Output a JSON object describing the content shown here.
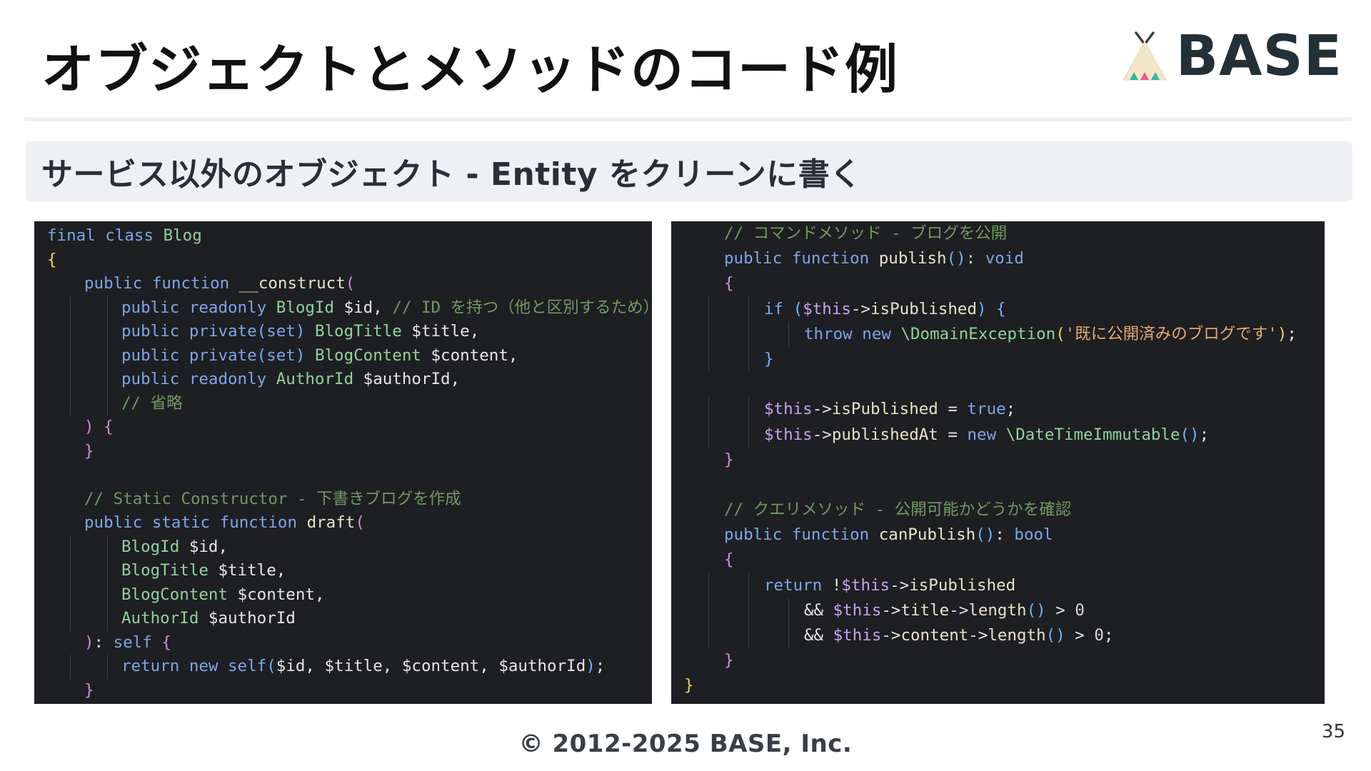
{
  "header": {
    "title": "オブジェクトとメソッドのコード例",
    "logo_text": "BASE"
  },
  "subtitle": "サービス以外のオブジェクト - Entity をクリーンに書く",
  "left_code": {
    "lines": [
      {
        "indent": 0,
        "tokens": [
          [
            "kw",
            "final "
          ],
          [
            "kw",
            "class "
          ],
          [
            "ty",
            "Blog"
          ]
        ]
      },
      {
        "indent": 0,
        "tokens": [
          [
            "br1",
            "{"
          ]
        ]
      },
      {
        "indent": 1,
        "tokens": [
          [
            "kw",
            "public "
          ],
          [
            "kw",
            "function "
          ],
          [
            "fn",
            "__construct"
          ],
          [
            "br2",
            "("
          ]
        ]
      },
      {
        "indent": 2,
        "tokens": [
          [
            "kw",
            "public "
          ],
          [
            "kw",
            "readonly "
          ],
          [
            "ty",
            "BlogId "
          ],
          [
            "vr",
            "$id"
          ],
          [
            "pl",
            ", "
          ],
          [
            "cm",
            "// ID を持つ（他と区別するため）"
          ]
        ]
      },
      {
        "indent": 2,
        "tokens": [
          [
            "kw",
            "public "
          ],
          [
            "kw",
            "private"
          ],
          [
            "br3",
            "("
          ],
          [
            "kw",
            "set"
          ],
          [
            "br3",
            ")"
          ],
          [
            "pl",
            " "
          ],
          [
            "ty",
            "BlogTitle "
          ],
          [
            "vr",
            "$title"
          ],
          [
            "pl",
            ","
          ]
        ]
      },
      {
        "indent": 2,
        "tokens": [
          [
            "kw",
            "public "
          ],
          [
            "kw",
            "private"
          ],
          [
            "br3",
            "("
          ],
          [
            "kw",
            "set"
          ],
          [
            "br3",
            ")"
          ],
          [
            "pl",
            " "
          ],
          [
            "ty",
            "BlogContent "
          ],
          [
            "vr",
            "$content"
          ],
          [
            "pl",
            ","
          ]
        ]
      },
      {
        "indent": 2,
        "tokens": [
          [
            "kw",
            "public "
          ],
          [
            "kw",
            "readonly "
          ],
          [
            "ty",
            "AuthorId "
          ],
          [
            "vr",
            "$authorId"
          ],
          [
            "pl",
            ","
          ]
        ]
      },
      {
        "indent": 2,
        "tokens": [
          [
            "cm",
            "// 省略"
          ]
        ]
      },
      {
        "indent": 1,
        "tokens": [
          [
            "br2",
            ")"
          ],
          [
            "pl",
            " "
          ],
          [
            "br2",
            "{"
          ]
        ]
      },
      {
        "indent": 1,
        "tokens": [
          [
            "br2",
            "}"
          ]
        ]
      },
      {
        "indent": 0,
        "tokens": []
      },
      {
        "indent": 1,
        "tokens": [
          [
            "cm",
            "// Static Constructor - 下書きブログを作成"
          ]
        ]
      },
      {
        "indent": 1,
        "tokens": [
          [
            "kw",
            "public "
          ],
          [
            "kw",
            "static "
          ],
          [
            "kw",
            "function "
          ],
          [
            "fn",
            "draft"
          ],
          [
            "br2",
            "("
          ]
        ]
      },
      {
        "indent": 2,
        "tokens": [
          [
            "ty",
            "BlogId "
          ],
          [
            "vr",
            "$id"
          ],
          [
            "pl",
            ","
          ]
        ]
      },
      {
        "indent": 2,
        "tokens": [
          [
            "ty",
            "BlogTitle "
          ],
          [
            "vr",
            "$title"
          ],
          [
            "pl",
            ","
          ]
        ]
      },
      {
        "indent": 2,
        "tokens": [
          [
            "ty",
            "BlogContent "
          ],
          [
            "vr",
            "$content"
          ],
          [
            "pl",
            ","
          ]
        ]
      },
      {
        "indent": 2,
        "tokens": [
          [
            "ty",
            "AuthorId "
          ],
          [
            "vr",
            "$authorId"
          ]
        ]
      },
      {
        "indent": 1,
        "tokens": [
          [
            "br2",
            ")"
          ],
          [
            "pl",
            ": "
          ],
          [
            "kw",
            "self "
          ],
          [
            "br2",
            "{"
          ]
        ]
      },
      {
        "indent": 2,
        "tokens": [
          [
            "kw",
            "return "
          ],
          [
            "kw",
            "new "
          ],
          [
            "kw",
            "self"
          ],
          [
            "br3",
            "("
          ],
          [
            "vr",
            "$id"
          ],
          [
            "pl",
            ", "
          ],
          [
            "vr",
            "$title"
          ],
          [
            "pl",
            ", "
          ],
          [
            "vr",
            "$content"
          ],
          [
            "pl",
            ", "
          ],
          [
            "vr",
            "$authorId"
          ],
          [
            "br3",
            ")"
          ],
          [
            "pl",
            ";"
          ]
        ]
      },
      {
        "indent": 1,
        "tokens": [
          [
            "br2",
            "}"
          ]
        ]
      }
    ]
  },
  "right_code": {
    "lines": [
      {
        "indent": 1,
        "tokens": [
          [
            "cm",
            "// コマンドメソッド - ブログを公開"
          ]
        ]
      },
      {
        "indent": 1,
        "tokens": [
          [
            "kw",
            "public "
          ],
          [
            "kw",
            "function "
          ],
          [
            "fn",
            "publish"
          ],
          [
            "br3",
            "()"
          ],
          [
            "pl",
            ": "
          ],
          [
            "kw",
            "void"
          ]
        ]
      },
      {
        "indent": 1,
        "tokens": [
          [
            "br2",
            "{"
          ]
        ]
      },
      {
        "indent": 2,
        "tokens": [
          [
            "kw",
            "if "
          ],
          [
            "br3",
            "("
          ],
          [
            "dol",
            "$this"
          ],
          [
            "op",
            "->"
          ],
          [
            "fn",
            "isPublished"
          ],
          [
            "br3",
            ")"
          ],
          [
            "pl",
            " "
          ],
          [
            "br3",
            "{"
          ]
        ]
      },
      {
        "indent": 3,
        "tokens": [
          [
            "kw",
            "throw "
          ],
          [
            "kw",
            "new "
          ],
          [
            "ty",
            "\\DomainException"
          ],
          [
            "br1",
            "("
          ],
          [
            "st",
            "'既に公開済みのブログです'"
          ],
          [
            "br1",
            ")"
          ],
          [
            "pl",
            ";"
          ]
        ]
      },
      {
        "indent": 2,
        "tokens": [
          [
            "br3",
            "}"
          ]
        ]
      },
      {
        "indent": 0,
        "tokens": []
      },
      {
        "indent": 2,
        "tokens": [
          [
            "dol",
            "$this"
          ],
          [
            "op",
            "->"
          ],
          [
            "fn",
            "isPublished"
          ],
          [
            "pl",
            " = "
          ],
          [
            "kw",
            "true"
          ],
          [
            "pl",
            ";"
          ]
        ]
      },
      {
        "indent": 2,
        "tokens": [
          [
            "dol",
            "$this"
          ],
          [
            "op",
            "->"
          ],
          [
            "fn",
            "publishedAt"
          ],
          [
            "pl",
            " = "
          ],
          [
            "kw",
            "new "
          ],
          [
            "ty",
            "\\DateTimeImmutable"
          ],
          [
            "br3",
            "()"
          ],
          [
            "pl",
            ";"
          ]
        ]
      },
      {
        "indent": 1,
        "tokens": [
          [
            "br2",
            "}"
          ]
        ]
      },
      {
        "indent": 0,
        "tokens": []
      },
      {
        "indent": 1,
        "tokens": [
          [
            "cm",
            "// クエリメソッド - 公開可能かどうかを確認"
          ]
        ]
      },
      {
        "indent": 1,
        "tokens": [
          [
            "kw",
            "public "
          ],
          [
            "kw",
            "function "
          ],
          [
            "fn",
            "canPublish"
          ],
          [
            "br3",
            "()"
          ],
          [
            "pl",
            ": "
          ],
          [
            "kw",
            "bool"
          ]
        ]
      },
      {
        "indent": 1,
        "tokens": [
          [
            "br2",
            "{"
          ]
        ]
      },
      {
        "indent": 2,
        "tokens": [
          [
            "kw",
            "return "
          ],
          [
            "pl",
            "!"
          ],
          [
            "dol",
            "$this"
          ],
          [
            "op",
            "->"
          ],
          [
            "fn",
            "isPublished"
          ]
        ]
      },
      {
        "indent": 3,
        "tokens": [
          [
            "pl",
            "&& "
          ],
          [
            "dol",
            "$this"
          ],
          [
            "op",
            "->"
          ],
          [
            "fn",
            "title"
          ],
          [
            "op",
            "->"
          ],
          [
            "fn",
            "length"
          ],
          [
            "br3",
            "()"
          ],
          [
            "pl",
            " > "
          ],
          [
            "nu",
            "0"
          ]
        ]
      },
      {
        "indent": 3,
        "tokens": [
          [
            "pl",
            "&& "
          ],
          [
            "dol",
            "$this"
          ],
          [
            "op",
            "->"
          ],
          [
            "fn",
            "content"
          ],
          [
            "op",
            "->"
          ],
          [
            "fn",
            "length"
          ],
          [
            "br3",
            "()"
          ],
          [
            "pl",
            " > "
          ],
          [
            "nu",
            "0"
          ],
          [
            "pl",
            ";"
          ]
        ]
      },
      {
        "indent": 1,
        "tokens": [
          [
            "br2",
            "}"
          ]
        ]
      },
      {
        "indent": 0,
        "tokens": [
          [
            "br1",
            "}"
          ]
        ]
      }
    ]
  },
  "footer": {
    "copyright": "© 2012-2025 BASE, Inc.",
    "page_number": "35"
  },
  "colors": {
    "code_bg": "#1e1f22",
    "subtitle_bg": "#eef0f4",
    "logo_dark": "#243038"
  }
}
